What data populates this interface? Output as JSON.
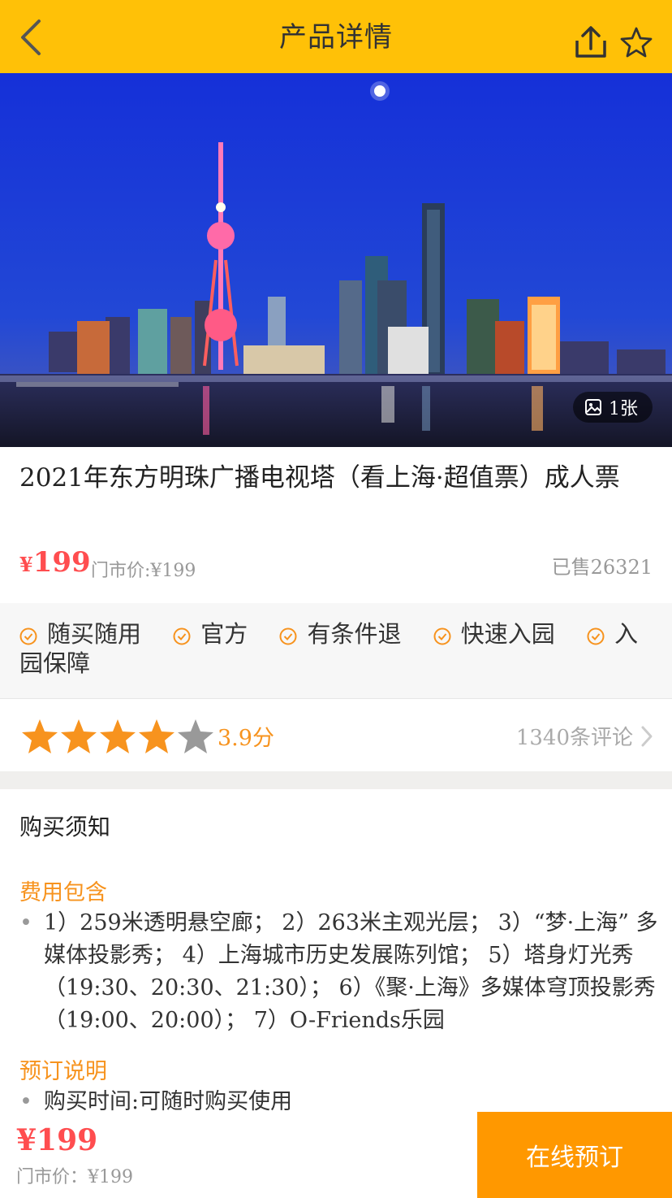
{
  "header": {
    "title": "产品详情"
  },
  "hero": {
    "photo_count": "1张"
  },
  "product": {
    "title": "2021年东方明珠广播电视塔（看上海·超值票）成人票",
    "price_symbol": "¥",
    "price": "199",
    "market_price": "门市价:¥199",
    "sold": "已售26321"
  },
  "tags": [
    "随买随用",
    "官方",
    "有条件退",
    "快速入园",
    "入园保障"
  ],
  "rating": {
    "stars": 3.9,
    "score": "3.9分",
    "comments": "1340条评论"
  },
  "notice": {
    "title": "购买须知",
    "fee_label": "费用包含",
    "fee_text": "1）259米透明悬空廊； 2）263米主观光层； 3）“梦·上海” 多媒体投影秀； 4）上海城市历史发展陈列馆； 5）塔身灯光秀（19:30、20:30、21:30）； 6）《聚·上海》多媒体穹顶投影秀（19:00、20:00）； 7）O-Friends乐园",
    "booking_label": "预订说明",
    "booking_text": "购买时间:可随时购买使用",
    "bullet": "•"
  },
  "bottom": {
    "price": "¥199",
    "market_price": "门市价：¥199",
    "book_label": "在线预订"
  },
  "colors": {
    "header_bg": "#ffc107",
    "price": "#ff4d4f",
    "accent": "#f7931e",
    "book_button": "#ff9800"
  }
}
